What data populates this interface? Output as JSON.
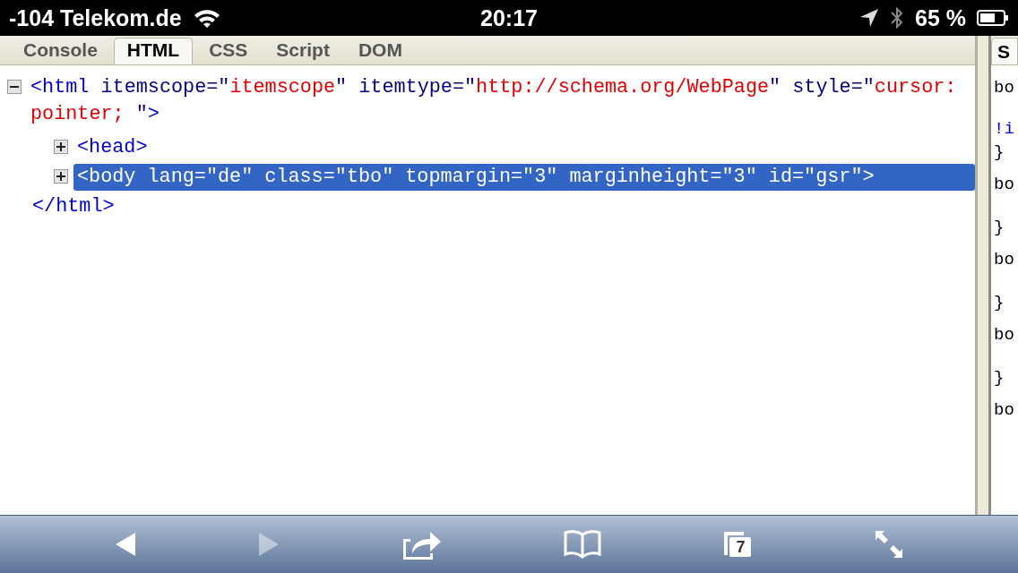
{
  "status_bar": {
    "carrier": "-104 Telekom.de",
    "time": "20:17",
    "battery": "65 %"
  },
  "tabs": [
    {
      "label": "Console",
      "selected": false
    },
    {
      "label": "HTML",
      "selected": true
    },
    {
      "label": "CSS",
      "selected": false
    },
    {
      "label": "Script",
      "selected": false
    },
    {
      "label": "DOM",
      "selected": false
    }
  ],
  "side_tab": {
    "label": "S"
  },
  "tree": [
    {
      "expanded": true,
      "selected": false,
      "tokens": [
        {
          "kind": "tag",
          "text": "<html"
        },
        {
          "kind": "attr",
          "text": " itemscope=\""
        },
        {
          "kind": "value",
          "text": "itemscope"
        },
        {
          "kind": "attr",
          "text": "\" itemtype=\""
        },
        {
          "kind": "value",
          "text": "http://schema.org/WebPage"
        },
        {
          "kind": "attr",
          "text": "\" style=\""
        },
        {
          "kind": "value",
          "text": "cursor: pointer; "
        },
        {
          "kind": "attr",
          "text": "\""
        },
        {
          "kind": "tag",
          "text": ">"
        }
      ],
      "children": [
        {
          "expanded": false,
          "selected": false,
          "tokens": [
            {
              "kind": "tag",
              "text": "<head>"
            }
          ]
        },
        {
          "expanded": false,
          "selected": true,
          "tokens": [
            {
              "kind": "tag",
              "text": "<body"
            },
            {
              "kind": "attr",
              "text": " lang=\""
            },
            {
              "kind": "value",
              "text": "de"
            },
            {
              "kind": "attr",
              "text": "\" class=\""
            },
            {
              "kind": "value",
              "text": "tbo"
            },
            {
              "kind": "attr",
              "text": "\" topmargin=\""
            },
            {
              "kind": "value",
              "text": "3"
            },
            {
              "kind": "attr",
              "text": "\" marginheight=\""
            },
            {
              "kind": "value",
              "text": "3"
            },
            {
              "kind": "attr",
              "text": "\" id=\""
            },
            {
              "kind": "value",
              "text": "gsr"
            },
            {
              "kind": "attr",
              "text": "\""
            },
            {
              "kind": "tag",
              "text": ">"
            }
          ]
        }
      ],
      "closing": "</html>"
    }
  ],
  "css_lines": [
    {
      "kind": "selector",
      "text": "bo"
    },
    {
      "kind": "important",
      "text": "!i"
    },
    {
      "kind": "close",
      "text": "}"
    },
    {
      "kind": "selector",
      "text": "bo"
    },
    {
      "kind": "close",
      "text": "}"
    },
    {
      "kind": "selector",
      "text": "bo"
    },
    {
      "kind": "close-far",
      "text": "}"
    },
    {
      "kind": "selector",
      "text": "bo"
    },
    {
      "kind": "close",
      "text": "}"
    },
    {
      "kind": "selector",
      "text": "bo"
    }
  ],
  "toolbar": [
    {
      "kind": "back",
      "disabled": false
    },
    {
      "kind": "forward",
      "disabled": true
    },
    {
      "kind": "share",
      "disabled": false
    },
    {
      "kind": "bookmarks",
      "disabled": false
    },
    {
      "kind": "pages",
      "disabled": false,
      "count": "7"
    },
    {
      "kind": "fullscreen",
      "disabled": false
    }
  ]
}
